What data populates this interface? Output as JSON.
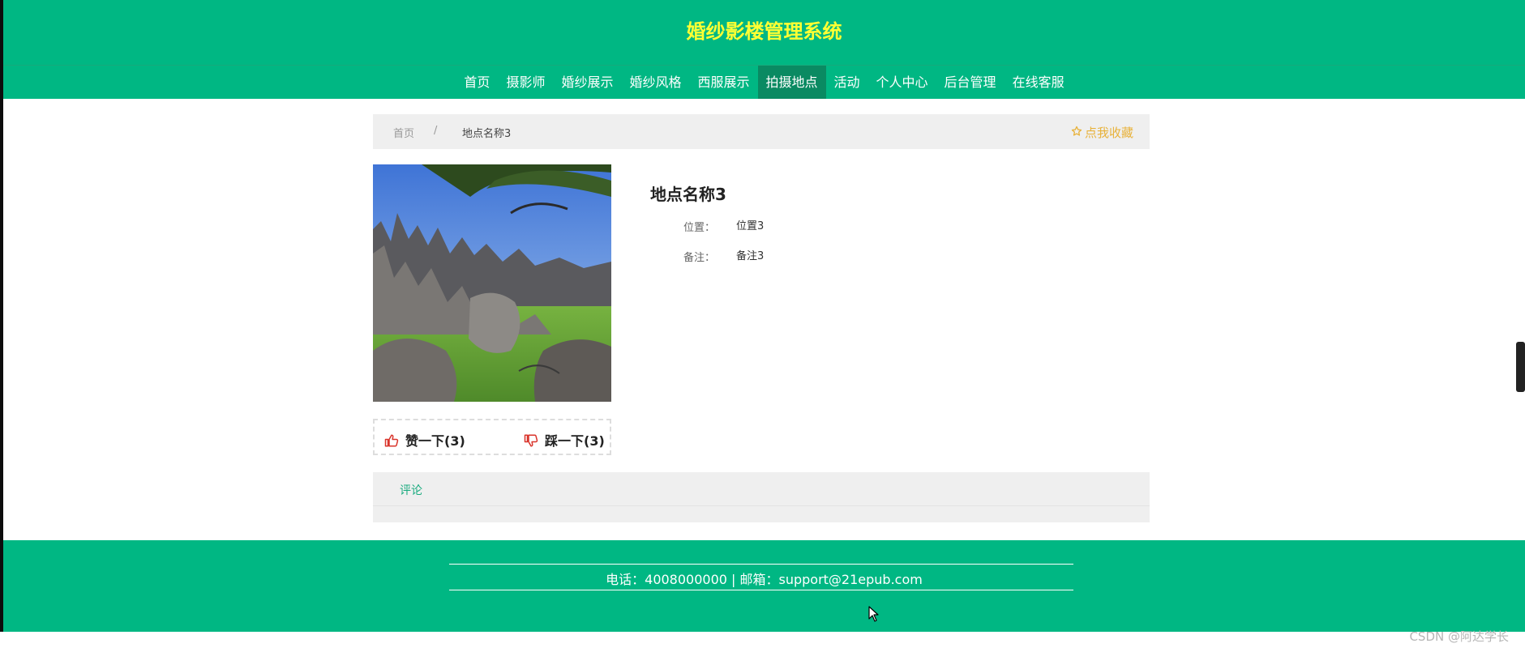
{
  "header": {
    "title": "婚纱影楼管理系统"
  },
  "nav": {
    "items": [
      "首页",
      "摄影师",
      "婚纱展示",
      "婚纱风格",
      "西服展示",
      "拍摄地点",
      "活动",
      "个人中心",
      "后台管理",
      "在线客服"
    ],
    "active": "拍摄地点"
  },
  "breadcrumb": {
    "home": "首页",
    "separator": "/",
    "current": "地点名称3",
    "favorite_label": "点我收藏",
    "favorite_icon": "star-icon"
  },
  "detail": {
    "title": "地点名称3",
    "fields": [
      {
        "label": "位置：",
        "value": "位置3"
      },
      {
        "label": "备注：",
        "value": "备注3"
      }
    ]
  },
  "vote": {
    "like_label": "赞一下(3)",
    "dislike_label": "踩一下(3)",
    "like_icon": "thumbs-up-icon",
    "dislike_icon": "thumbs-down-icon"
  },
  "comments": {
    "tab_label": "评论"
  },
  "footer": {
    "contact": "电话：4008000000 | 邮箱：support@21epub.com"
  },
  "watermark": "CSDN @阿达学长",
  "colors": {
    "brand": "#00b783",
    "nav_active": "#0a8a62",
    "title": "#ffff33",
    "favorite": "#e8b23a",
    "vote_icon": "#d9342b"
  }
}
